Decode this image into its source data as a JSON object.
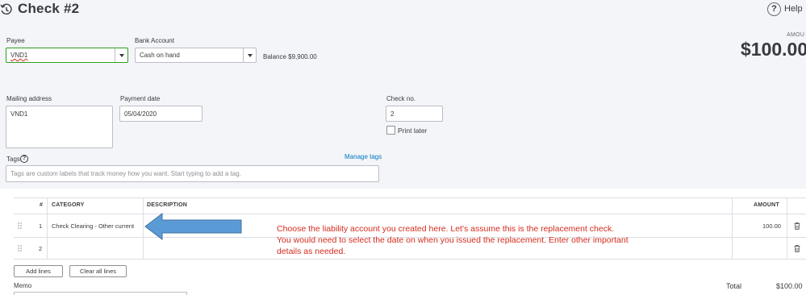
{
  "header": {
    "title": "Check #2",
    "help_label": "Help"
  },
  "form": {
    "payee_label": "Payee",
    "payee_value": "VND1",
    "bank_account_label": "Bank Account",
    "bank_account_value": "Cash on hand",
    "balance_label": "Balance",
    "balance_value": "$9,900.00",
    "amount_label": "AMOU",
    "amount_value": "$100.00",
    "mailing_address_label": "Mailing address",
    "mailing_address_value": "VND1",
    "payment_date_label": "Payment date",
    "payment_date_value": "05/04/2020",
    "check_no_label": "Check no.",
    "check_no_value": "2",
    "print_later_label": "Print later",
    "tags_label": "Tags",
    "manage_tags_label": "Manage tags",
    "tags_placeholder": "Tags are custom labels that track money how you want. Start typing to add a tag."
  },
  "table": {
    "headers": {
      "num": "#",
      "category": "CATEGORY",
      "description": "DESCRIPTION",
      "amount": "AMOUNT"
    },
    "rows": [
      {
        "num": "1",
        "category": "Check Clearing - Other current",
        "description": "",
        "amount": "100.00"
      },
      {
        "num": "2",
        "category": "",
        "description": "",
        "amount": ""
      }
    ]
  },
  "buttons": {
    "add_lines": "Add lines",
    "clear_all_lines": "Clear all lines"
  },
  "memo_label": "Memo",
  "total_label": "Total",
  "total_value": "$100.00",
  "annotation": {
    "line1": "Choose the liability account you created here. Let's assume this is the replacement check.",
    "line2": "You would need to select the date on when you issued the replacement. Enter other important",
    "line3": "details as needed.",
    "arrow_color": "#5b9bd5",
    "text_color": "#d52b1e"
  },
  "colors": {
    "brand_green": "#2ca01c",
    "link_blue": "#0077c5",
    "header_bg": "#f4f5f8"
  },
  "icons": {
    "history": "history-icon",
    "help": "help-icon",
    "dropdown": "chevron-down-icon",
    "tags_help": "question-icon",
    "drag": "drag-handle-icon",
    "delete": "trash-icon"
  }
}
